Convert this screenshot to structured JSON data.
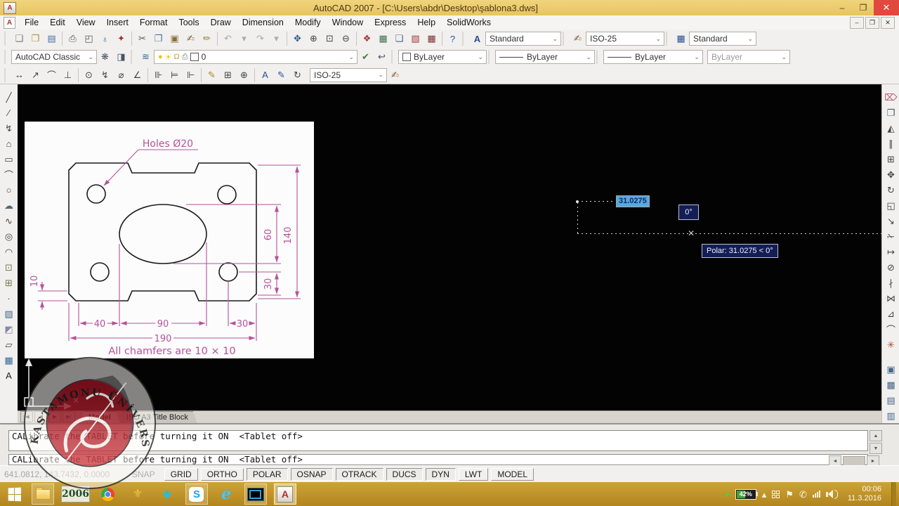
{
  "window": {
    "title": "AutoCAD 2007 - [C:\\Users\\abdr\\Desktop\\şablona3.dws]"
  },
  "ui": {
    "app_badge": "A",
    "minimize": "–",
    "restore": "❐",
    "close": "✕",
    "chevron": "⌄",
    "scroll_up": "▲",
    "scroll_down": "▼",
    "scroll_left": "◄",
    "scroll_right": "►"
  },
  "menu": {
    "items": [
      "File",
      "Edit",
      "View",
      "Insert",
      "Format",
      "Tools",
      "Draw",
      "Dimension",
      "Modify",
      "Window",
      "Express",
      "Help",
      "SolidWorks"
    ]
  },
  "toolbars": {
    "standard": [
      {
        "n": "new-icon",
        "g": "❑",
        "c": "#777777"
      },
      {
        "n": "open-icon",
        "g": "❒",
        "c": "#b8913a"
      },
      {
        "n": "save-icon",
        "g": "▤",
        "c": "#4d6fa5"
      },
      "|",
      {
        "n": "plot-icon",
        "g": "⎙",
        "c": "#555555"
      },
      {
        "n": "plot-preview-icon",
        "g": "◰",
        "c": "#556"
      },
      {
        "n": "publish-icon",
        "g": "♁",
        "c": "#3a6ea5"
      },
      {
        "n": "3d-dwf-icon",
        "g": "✦",
        "c": "#a33333"
      },
      "|",
      {
        "n": "cut-icon",
        "g": "✂",
        "c": "#555555"
      },
      {
        "n": "copy-icon",
        "g": "❐",
        "c": "#4d6fa5"
      },
      {
        "n": "paste-icon",
        "g": "▣",
        "c": "#8a6d3b"
      },
      {
        "n": "match-properties-icon",
        "g": "✍",
        "c": "#8a5a2b"
      },
      {
        "n": "block-editor-icon",
        "g": "✏",
        "c": "#9a7b2d"
      },
      "|",
      {
        "n": "undo-icon",
        "g": "↶",
        "c": "#aaaaaa"
      },
      {
        "n": "undo-list-icon",
        "g": "▾",
        "c": "#aaaaaa"
      },
      {
        "n": "redo-icon",
        "g": "↷",
        "c": "#aaaaaa"
      },
      {
        "n": "redo-list-icon",
        "g": "▾",
        "c": "#aaaaaa"
      },
      "|",
      {
        "n": "pan-icon",
        "g": "✥",
        "c": "#2f5a8f"
      },
      {
        "n": "zoom-realtime-icon",
        "g": "⊕",
        "c": "#444444"
      },
      {
        "n": "zoom-window-icon",
        "g": "⊡",
        "c": "#444444"
      },
      {
        "n": "zoom-previous-icon",
        "g": "⊖",
        "c": "#444444"
      },
      "|",
      {
        "n": "properties-palette-icon",
        "g": "❖",
        "c": "#a03a3a"
      },
      {
        "n": "designcenter-icon",
        "g": "▦",
        "c": "#3f6f4f"
      },
      {
        "n": "sheetset-manager-icon",
        "g": "❏",
        "c": "#46628c"
      },
      {
        "n": "markup-manager-icon",
        "g": "▧",
        "c": "#a03a3a"
      },
      {
        "n": "quickcalc-icon",
        "g": "▦",
        "c": "#7a3030"
      },
      "|",
      {
        "n": "help-icon",
        "g": "?",
        "c": "#1b54a8"
      }
    ],
    "styles": {
      "text_style": "Standard",
      "dim_style": "ISO-25",
      "table_style": "Standard"
    },
    "styles_icons": [
      {
        "n": "text-style-icon",
        "g": "A",
        "c": "#2a4d8f"
      },
      {
        "n": "dim-style-icon",
        "g": "✍",
        "c": "#8a5a2b"
      },
      {
        "n": "table-style-icon",
        "g": "▦",
        "c": "#2a4d8f"
      }
    ],
    "workspaces": {
      "value": "AutoCAD Classic"
    },
    "workspace_icons": [
      {
        "n": "workspace-settings-icon",
        "g": "❋",
        "c": "#445566"
      },
      {
        "n": "my-workspace-icon",
        "g": "◨",
        "c": "#445566"
      }
    ],
    "layers": {
      "manager_icon": {
        "n": "layer-manager-icon",
        "g": "≋",
        "c": "#35679a"
      },
      "state_icons": [
        {
          "n": "layer-on-icon",
          "g": "●",
          "c": "#e8c520"
        },
        {
          "n": "layer-freeze-icon",
          "g": "☀",
          "c": "#e8c520"
        },
        {
          "n": "layer-lock-icon",
          "g": "Ω",
          "c": "#c09a40"
        },
        {
          "n": "layer-plot-icon",
          "g": "⎙",
          "c": "#777777"
        }
      ],
      "value": "0",
      "after_icons": [
        {
          "n": "make-layer-current-icon",
          "g": "✔",
          "c": "#3a7a4a"
        },
        {
          "n": "layer-previous-icon",
          "g": "↩",
          "c": "#445566"
        }
      ]
    },
    "properties": {
      "color": "ByLayer",
      "linetype": "ByLayer",
      "lineweight": "ByLayer",
      "plotstyle": "ByLayer"
    },
    "dimension_row": [
      {
        "n": "dim-linear-icon",
        "g": "↔"
      },
      {
        "n": "dim-aligned-icon",
        "g": "↗"
      },
      {
        "n": "dim-arc-length-icon",
        "g": "⌒"
      },
      {
        "n": "dim-ordinate-icon",
        "g": "⊥"
      },
      "|",
      {
        "n": "dim-radius-icon",
        "g": "⊙"
      },
      {
        "n": "dim-jogged-icon",
        "g": "↯"
      },
      {
        "n": "dim-diameter-icon",
        "g": "⌀"
      },
      {
        "n": "dim-angular-icon",
        "g": "∠"
      },
      "|",
      {
        "n": "quick-dimension-icon",
        "g": "⊪"
      },
      {
        "n": "dim-baseline-icon",
        "g": "⊨"
      },
      {
        "n": "dim-continue-icon",
        "g": "⊩"
      },
      "|",
      {
        "n": "quick-leader-icon",
        "g": "✎",
        "c": "#a8842a"
      },
      {
        "n": "tolerance-icon",
        "g": "⊞"
      },
      {
        "n": "center-mark-icon",
        "g": "⊕"
      },
      "|",
      {
        "n": "dim-edit-icon",
        "g": "A",
        "c": "#2a4d8f"
      },
      {
        "n": "dim-text-edit-icon",
        "g": "✎",
        "c": "#2a4d8f"
      },
      {
        "n": "dim-update-icon",
        "g": "↻"
      }
    ],
    "dim_style_value": "ISO-25",
    "dim_style_icon": {
      "n": "dim-style-manager-icon",
      "g": "✍",
      "c": "#8a5a2b"
    },
    "draw_left": [
      {
        "n": "line-icon",
        "g": "╱"
      },
      {
        "n": "construction-line-icon",
        "g": "⁄"
      },
      {
        "n": "polyline-icon",
        "g": "↯"
      },
      {
        "n": "polygon-icon",
        "g": "⌂"
      },
      {
        "n": "rectangle-icon",
        "g": "▭"
      },
      {
        "n": "arc-icon",
        "g": "⌒"
      },
      {
        "n": "circle-icon",
        "g": "○"
      },
      {
        "n": "revcloud-icon",
        "g": "☁",
        "c": "#556677"
      },
      {
        "n": "spline-icon",
        "g": "∿"
      },
      {
        "n": "ellipse-icon",
        "g": "◎"
      },
      {
        "n": "ellipse-arc-icon",
        "g": "◠"
      },
      {
        "n": "insert-block-icon",
        "g": "⊡",
        "c": "#7a7a50"
      },
      {
        "n": "make-block-icon",
        "g": "⊞",
        "c": "#7a7a50"
      },
      {
        "n": "point-icon",
        "g": "·"
      },
      {
        "n": "hatch-icon",
        "g": "▨",
        "c": "#446688"
      },
      {
        "n": "gradient-icon",
        "g": "◩",
        "c": "#8888aa"
      },
      {
        "n": "region-icon",
        "g": "▱"
      },
      {
        "n": "table-icon",
        "g": "▦",
        "c": "#336699"
      },
      {
        "n": "mtext-icon",
        "g": "A",
        "c": "#222222"
      }
    ],
    "modify_right": [
      {
        "n": "erase-icon",
        "g": "⌦",
        "c": "#b5527a"
      },
      {
        "n": "copy-object-icon",
        "g": "❐",
        "c": "#445566"
      },
      {
        "n": "mirror-icon",
        "g": "◭"
      },
      {
        "n": "offset-icon",
        "g": "∥"
      },
      {
        "n": "array-icon",
        "g": "⊞"
      },
      {
        "n": "move-icon",
        "g": "✥"
      },
      {
        "n": "rotate-icon",
        "g": "↻"
      },
      {
        "n": "scale-icon",
        "g": "◱"
      },
      {
        "n": "stretch-icon",
        "g": "↘"
      },
      {
        "n": "trim-icon",
        "g": "✁"
      },
      {
        "n": "extend-icon",
        "g": "↦"
      },
      {
        "n": "break-at-point-icon",
        "g": "⊘"
      },
      {
        "n": "break-icon",
        "g": "∤"
      },
      {
        "n": "join-icon",
        "g": "⋈"
      },
      {
        "n": "chamfer-icon",
        "g": "⊿"
      },
      {
        "n": "fillet-icon",
        "g": "⌒"
      },
      {
        "n": "explode-icon",
        "g": "✳",
        "c": "#b04a2a"
      }
    ],
    "draworder_right": [
      {
        "n": "bring-to-front-icon",
        "g": "▣",
        "c": "#446688"
      },
      {
        "n": "send-to-back-icon",
        "g": "▩",
        "c": "#446688"
      },
      {
        "n": "bring-above-icon",
        "g": "▤",
        "c": "#446688"
      },
      {
        "n": "send-under-icon",
        "g": "▥",
        "c": "#446688"
      }
    ]
  },
  "drawing": {
    "labels": {
      "holes_note": "Holes Ø20",
      "dim_140": "140",
      "dim_60": "60",
      "dim_30_right": "30",
      "dim_10": "10",
      "dim_40": "40",
      "dim_90": "90",
      "dim_30_bottom": "30",
      "dim_190": "190",
      "chamfer_note": "All chamfers are 10 × 10"
    }
  },
  "dyn": {
    "length": "31.0275",
    "angle": "0°",
    "tooltip": "Polar: 31.0275 < 0°"
  },
  "tabs": {
    "nav": [
      {
        "name": "tab-first-button",
        "glyph": "|◀"
      },
      {
        "name": "tab-prev-button",
        "glyph": "◀"
      },
      {
        "name": "tab-next-button",
        "glyph": "▶"
      },
      {
        "name": "tab-last-button",
        "glyph": "▶|"
      }
    ],
    "model": "Model",
    "layout": "ISO A3 Title Block"
  },
  "command": {
    "lines": [
      "CALibrate the TABLET before turning it ON  <Tablet off>",
      "CALibrate the TABLET before turning it ON  <Tablet off>"
    ]
  },
  "status": {
    "coords": "641.0812, 143.7432, 0.0000",
    "buttons": [
      {
        "label": "SNAP",
        "state": "disabled"
      },
      {
        "label": "GRID",
        "state": "raised"
      },
      {
        "label": "ORTHO",
        "state": "raised"
      },
      {
        "label": "POLAR",
        "state": "sunken"
      },
      {
        "label": "OSNAP",
        "state": "sunken"
      },
      {
        "label": "OTRACK",
        "state": "sunken"
      },
      {
        "label": "DUCS",
        "state": "sunken"
      },
      {
        "label": "DYN",
        "state": "sunken"
      },
      {
        "label": "LWT",
        "state": "raised"
      },
      {
        "label": "MODEL",
        "state": "raised"
      }
    ]
  },
  "taskbar": {
    "apps": [
      {
        "name": "file-explorer-app",
        "kind": "folder",
        "open": true
      },
      {
        "name": "app-2006-tile",
        "kind": "tile2006",
        "label": "2006"
      },
      {
        "name": "chrome-app",
        "kind": "chrome"
      },
      {
        "name": "autocad-tools-app",
        "kind": "glyph",
        "glyph": "⚜",
        "color": "#e8c54a"
      },
      {
        "name": "diamond-app",
        "kind": "glyph",
        "glyph": "◆",
        "color": "#35b8c8"
      },
      {
        "name": "skype-app",
        "kind": "skype",
        "open": true,
        "label": "S"
      },
      {
        "name": "internet-explorer-app",
        "kind": "ie",
        "label": "e"
      },
      {
        "name": "screen-app",
        "kind": "screen",
        "open": true
      },
      {
        "name": "autocad-2007-app",
        "kind": "acad",
        "open": true,
        "active": true,
        "label": "A"
      }
    ],
    "tray": [
      {
        "name": "power-plug-icon",
        "kind": "glyph",
        "glyph": "♥",
        "color": "#6cbf3e"
      },
      {
        "name": "battery-indicator",
        "kind": "battery"
      },
      {
        "name": "tray-expand-icon",
        "kind": "glyph",
        "glyph": "▴",
        "color": "#fdf6e0"
      },
      {
        "name": "action-center-icon",
        "kind": "winlogo"
      },
      {
        "name": "flag-icon",
        "kind": "glyph",
        "glyph": "⚑",
        "color": "#fdf6e0"
      },
      {
        "name": "device-icon",
        "kind": "glyph",
        "glyph": "✆",
        "color": "#fdf6e0"
      },
      {
        "name": "network-signal-icon",
        "kind": "signal"
      },
      {
        "name": "volume-icon",
        "kind": "speaker"
      }
    ],
    "battery": "42%",
    "clock": {
      "time": "00:06",
      "date": "11.3.2016"
    }
  },
  "watermark": {
    "text": "KASTAMONU ÜNİVERSİTESİ"
  },
  "colors": {
    "titlebar": "#e8c45e",
    "taskbar": "#c3942c",
    "canvas": "#030303",
    "dimension": "#b5529b",
    "dyn_box": "#131e55",
    "close_button": "#e2483d"
  }
}
